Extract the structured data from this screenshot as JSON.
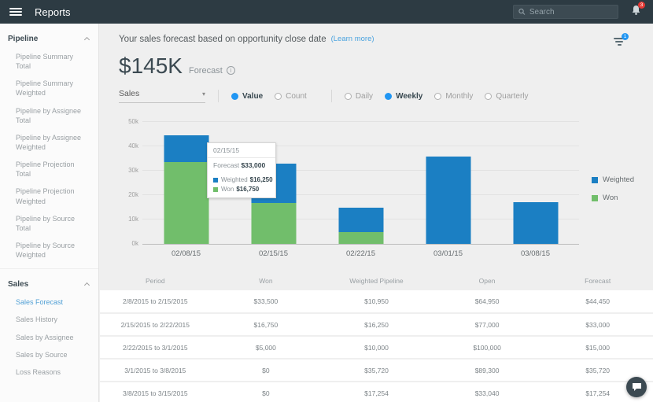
{
  "topbar": {
    "title": "Reports",
    "search": {
      "placeholder": "Search"
    },
    "notifications": {
      "badge": "3"
    }
  },
  "sidebar": {
    "sections": [
      {
        "label": "Pipeline",
        "items": [
          {
            "label": "Pipeline Summary Total",
            "active": false
          },
          {
            "label": "Pipeline Summary Weighted",
            "active": false
          },
          {
            "label": "Pipeline by Assignee Total",
            "active": false
          },
          {
            "label": "Pipeline by Assignee Weighted",
            "active": false
          },
          {
            "label": "Pipeline Projection Total",
            "active": false
          },
          {
            "label": "Pipeline Projection Weighted",
            "active": false
          },
          {
            "label": "Pipeline by Source Total",
            "active": false
          },
          {
            "label": "Pipeline by Source Weighted",
            "active": false
          }
        ]
      },
      {
        "label": "Sales",
        "items": [
          {
            "label": "Sales Forecast",
            "active": true
          },
          {
            "label": "Sales History",
            "active": false
          },
          {
            "label": "Sales by Assignee",
            "active": false
          },
          {
            "label": "Sales by Source",
            "active": false
          },
          {
            "label": "Loss Reasons",
            "active": false
          }
        ]
      }
    ]
  },
  "header": {
    "subtitle": "Your sales forecast based on opportunity close date",
    "learn_more": "(Learn more)",
    "filter_badge": "1",
    "kpi_value": "$145K",
    "kpi_label": "Forecast",
    "info_glyph": "i"
  },
  "filters": {
    "report_select": {
      "value": "Sales",
      "caret": "▾"
    },
    "mode": {
      "options": [
        "Value",
        "Count"
      ],
      "selected": "Value"
    },
    "interval": {
      "options": [
        "Daily",
        "Weekly",
        "Monthly",
        "Quarterly"
      ],
      "selected": "Weekly"
    }
  },
  "chart_data": {
    "type": "bar",
    "stacked": true,
    "categories": [
      "02/08/15",
      "02/15/15",
      "02/22/15",
      "03/01/15",
      "03/08/15"
    ],
    "series": [
      {
        "name": "Won",
        "color": "#71be6b",
        "values": [
          33500,
          16750,
          5000,
          0,
          0
        ]
      },
      {
        "name": "Weighted",
        "color": "#1b7fc3",
        "values": [
          10950,
          16250,
          10000,
          35720,
          17254
        ]
      }
    ],
    "title": "",
    "xlabel": "",
    "ylabel": "",
    "ylim": [
      0,
      50000
    ],
    "ytick_labels": [
      "0k",
      "10k",
      "20k",
      "30k",
      "40k",
      "50k"
    ],
    "grid": true,
    "legend_position": "right",
    "legend": [
      {
        "name": "Weighted",
        "color": "#1b7fc3"
      },
      {
        "name": "Won",
        "color": "#71be6b"
      }
    ],
    "tooltip": {
      "title": "02/15/15",
      "forecast_label": "Forecast",
      "forecast_value": "$33,000",
      "rows": [
        {
          "name": "Weighted",
          "value": "$16,250",
          "color": "#1b7fc3"
        },
        {
          "name": "Won",
          "value": "$16,750",
          "color": "#71be6b"
        }
      ]
    }
  },
  "table": {
    "columns": [
      "Period",
      "Won",
      "Weighted Pipeline",
      "Open",
      "Forecast"
    ],
    "rows": [
      [
        "2/8/2015 to 2/15/2015",
        "$33,500",
        "$10,950",
        "$64,950",
        "$44,450"
      ],
      [
        "2/15/2015 to 2/22/2015",
        "$16,750",
        "$16,250",
        "$77,000",
        "$33,000"
      ],
      [
        "2/22/2015 to 3/1/2015",
        "$5,000",
        "$10,000",
        "$100,000",
        "$15,000"
      ],
      [
        "3/1/2015 to 3/8/2015",
        "$0",
        "$35,720",
        "$89,300",
        "$35,720"
      ],
      [
        "3/8/2015 to 3/15/2015",
        "$0",
        "$17,254",
        "$33,040",
        "$17,254"
      ]
    ]
  },
  "colors": {
    "topbar_bg": "#2d3b43",
    "accent_blue": "#2196f3",
    "link_blue": "#4aa3df",
    "badge_red": "#e53935",
    "bar_blue": "#1b7fc3",
    "bar_green": "#71be6b"
  }
}
